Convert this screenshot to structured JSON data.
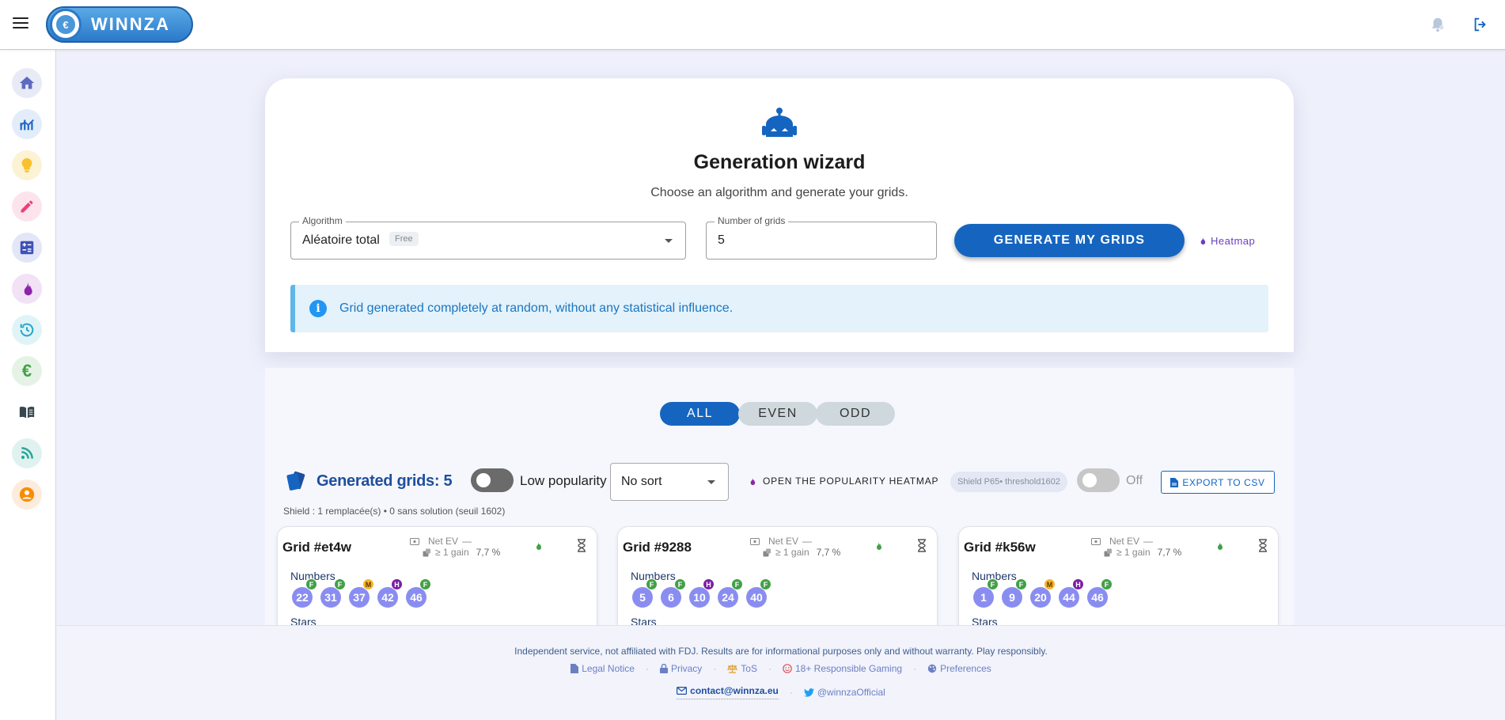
{
  "header": {
    "brand": "WINNZA",
    "brand_mark": "€",
    "icons": [
      "menu-icon",
      "notification-bell-icon",
      "logout-icon"
    ]
  },
  "sidebar": {
    "items": [
      {
        "name": "home",
        "icon": "home-icon",
        "color": "#5c6bc0"
      },
      {
        "name": "statistics",
        "icon": "chart-icon",
        "color": "#1e66c7"
      },
      {
        "name": "generator",
        "icon": "lightbulb-icon",
        "color": "#fbc02d"
      },
      {
        "name": "editor",
        "icon": "pencil-icon",
        "color": "#ec407a"
      },
      {
        "name": "calculator",
        "icon": "calculator-icon",
        "color": "#3f51b5"
      },
      {
        "name": "heatmap",
        "icon": "flame-icon",
        "color": "#8e24aa"
      },
      {
        "name": "history",
        "icon": "history-icon",
        "color": "#26a6c8"
      },
      {
        "name": "finance",
        "icon": "euro-icon",
        "color": "#43a047"
      },
      {
        "name": "guide",
        "icon": "book-icon",
        "color": "#37474f"
      },
      {
        "name": "feed",
        "icon": "rss-icon",
        "color": "#26a69a"
      },
      {
        "name": "account",
        "icon": "account-icon",
        "color": "#fb8c00"
      }
    ]
  },
  "wizard": {
    "title": "Generation wizard",
    "subtitle": "Choose an algorithm and generate your grids.",
    "algorithm_label": "Algorithm",
    "algorithm_value": "Aléatoire total",
    "algorithm_tag": "Free",
    "count_label": "Number of grids",
    "count_value": "5",
    "generate_label": "GENERATE MY GRIDS",
    "heatmap_label": "Heatmap",
    "info_text": "Grid generated completely at random, without any statistical influence."
  },
  "filters": {
    "all": "ALL",
    "even": "EVEN",
    "odd": "ODD",
    "active": "all"
  },
  "toolbar": {
    "generated": "Generated grids: 5",
    "low_popularity": "Low popularity",
    "sort_value": "No sort",
    "popularity_heatmap": "OPEN THE POPULARITY HEATMAP",
    "shield_chip": "Shield P65• threshold1602",
    "off": "Off",
    "export": "EXPORT TO CSV",
    "shield_line": "Shield : 1 remplacée(s) • 0 sans solution (seuil 1602)"
  },
  "grids": [
    {
      "title": "Grid #et4w",
      "net_ev_label": "Net EV",
      "net_ev_value": "—",
      "gain_label": "≥ 1 gain",
      "gain_value": "7,7 %",
      "numbers_label": "Numbers",
      "stars_label": "Stars",
      "balls": [
        {
          "n": "22",
          "b": "F"
        },
        {
          "n": "31",
          "b": "F"
        },
        {
          "n": "37",
          "b": "M"
        },
        {
          "n": "42",
          "b": "H"
        },
        {
          "n": "46",
          "b": "F"
        }
      ]
    },
    {
      "title": "Grid #9288",
      "net_ev_label": "Net EV",
      "net_ev_value": "—",
      "gain_label": "≥ 1 gain",
      "gain_value": "7,7 %",
      "numbers_label": "Numbers",
      "stars_label": "Stars",
      "balls": [
        {
          "n": "5",
          "b": "F"
        },
        {
          "n": "6",
          "b": "F"
        },
        {
          "n": "10",
          "b": "H"
        },
        {
          "n": "24",
          "b": "F"
        },
        {
          "n": "40",
          "b": "F"
        }
      ]
    },
    {
      "title": "Grid #k56w",
      "net_ev_label": "Net EV",
      "net_ev_value": "—",
      "gain_label": "≥ 1 gain",
      "gain_value": "7,7 %",
      "numbers_label": "Numbers",
      "stars_label": "Stars",
      "balls": [
        {
          "n": "1",
          "b": "F"
        },
        {
          "n": "9",
          "b": "F"
        },
        {
          "n": "20",
          "b": "M"
        },
        {
          "n": "44",
          "b": "H"
        },
        {
          "n": "46",
          "b": "F"
        }
      ]
    }
  ],
  "footer": {
    "disclaimer": "Independent service, not affiliated with FDJ. Results are for informational purposes only and without warranty. Play responsibly.",
    "legal": "Legal Notice",
    "privacy": "Privacy",
    "tos": "ToS",
    "responsible": "18+ Responsible Gaming",
    "preferences": "Preferences",
    "email": "contact@winnza.eu",
    "twitter": "@winnzaOfficial"
  },
  "colors": {
    "primary": "#1565c0",
    "ball": "#8a8df0",
    "badge_f": "#43a047",
    "badge_m": "#f9b42b",
    "badge_h": "#7b1fa2"
  }
}
